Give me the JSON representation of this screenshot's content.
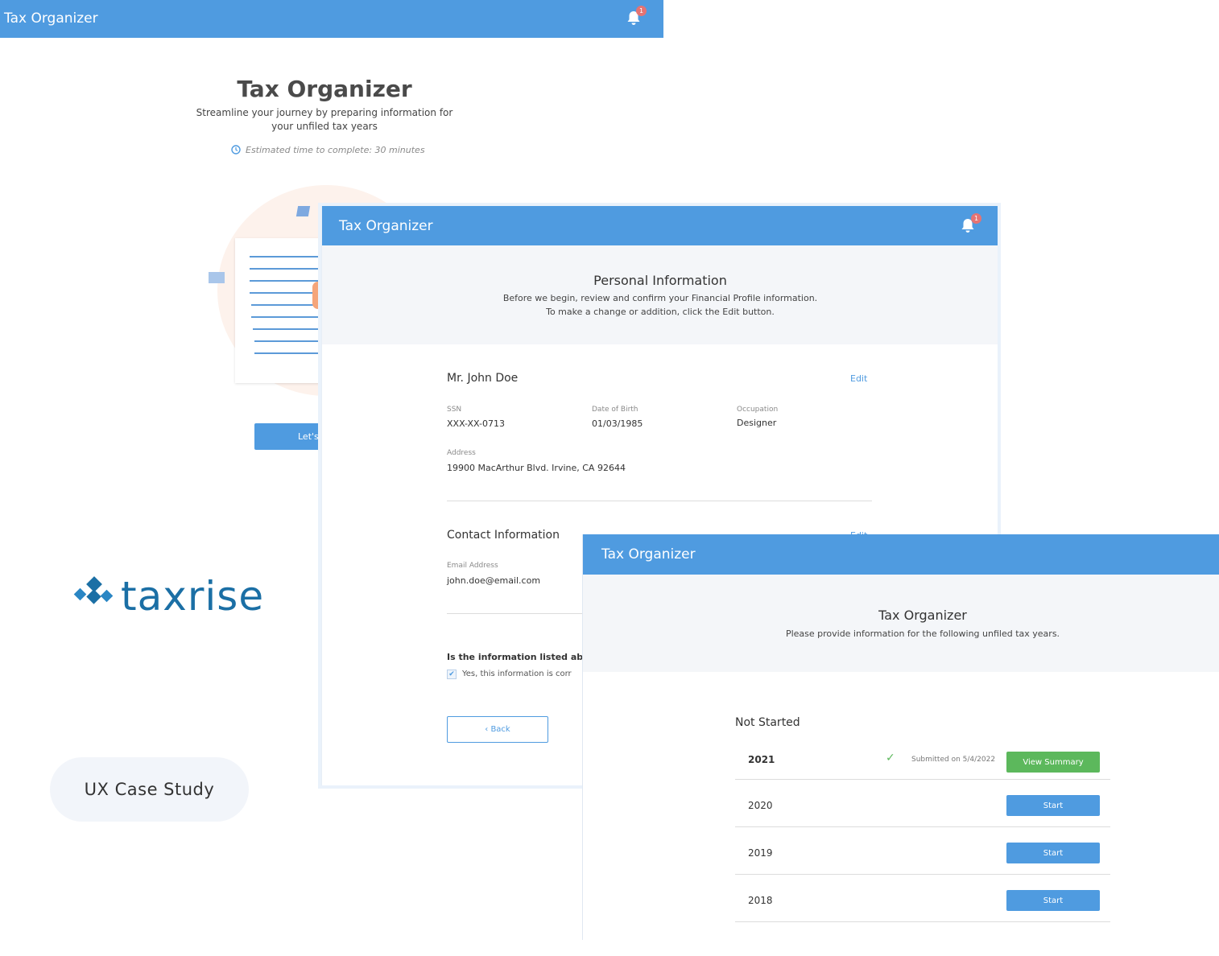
{
  "screen1": {
    "app_title": "Tax Organizer",
    "notification_count": "1",
    "title": "Tax Organizer",
    "subtitle": "Streamline your journey by preparing information for your unfiled tax years",
    "estimate": "Estimated time to complete: 30 minutes",
    "cta_label": "Let's s"
  },
  "brand": {
    "logo_text": "taxrise",
    "pill": "UX Case Study"
  },
  "screen2": {
    "app_title": "Tax Organizer",
    "notification_count": "1",
    "heading": "Personal Information",
    "intro_line1": "Before we begin, review and confirm your Financial Profile information.",
    "intro_line2": "To make a change or addition, click the Edit button.",
    "name": "Mr. John Doe",
    "edit_label": "Edit",
    "ssn_label": "SSN",
    "ssn_value": "XXX-XX-0713",
    "dob_label": "Date of Birth",
    "dob_value": "01/03/1985",
    "occupation_label": "Occupation",
    "occupation_value": "Designer",
    "address_label": "Address",
    "address_value": "19900 MacArthur Blvd. Irvine, CA 92644",
    "contact_heading": "Contact Information",
    "contact_edit_label": "Edit",
    "email_label": "Email Address",
    "email_value": "john.doe@email.com",
    "question": "Is the information listed abo",
    "checkbox_label": "Yes, this information is corr",
    "back_label": "‹ Back"
  },
  "screen3": {
    "app_title": "Tax Organizer",
    "heading": "Tax Organizer",
    "subheading": "Please provide information for the following unfiled tax years.",
    "status_label": "Not Started",
    "rows": [
      {
        "year": "2021",
        "submitted": "Submitted on 5/4/2022",
        "button": "View Summary"
      },
      {
        "year": "2020",
        "button": "Start"
      },
      {
        "year": "2019",
        "button": "Start"
      },
      {
        "year": "2018",
        "button": "Start"
      }
    ]
  },
  "colors": {
    "header_blue": "#4f9be0",
    "success_green": "#5cb85c",
    "badge_red": "#e57373",
    "brand_blue": "#1b6fa5"
  },
  "icons": [
    "bell-icon",
    "clock-icon",
    "check-icon",
    "checkbox-icon",
    "taxrise-logo-icon"
  ]
}
